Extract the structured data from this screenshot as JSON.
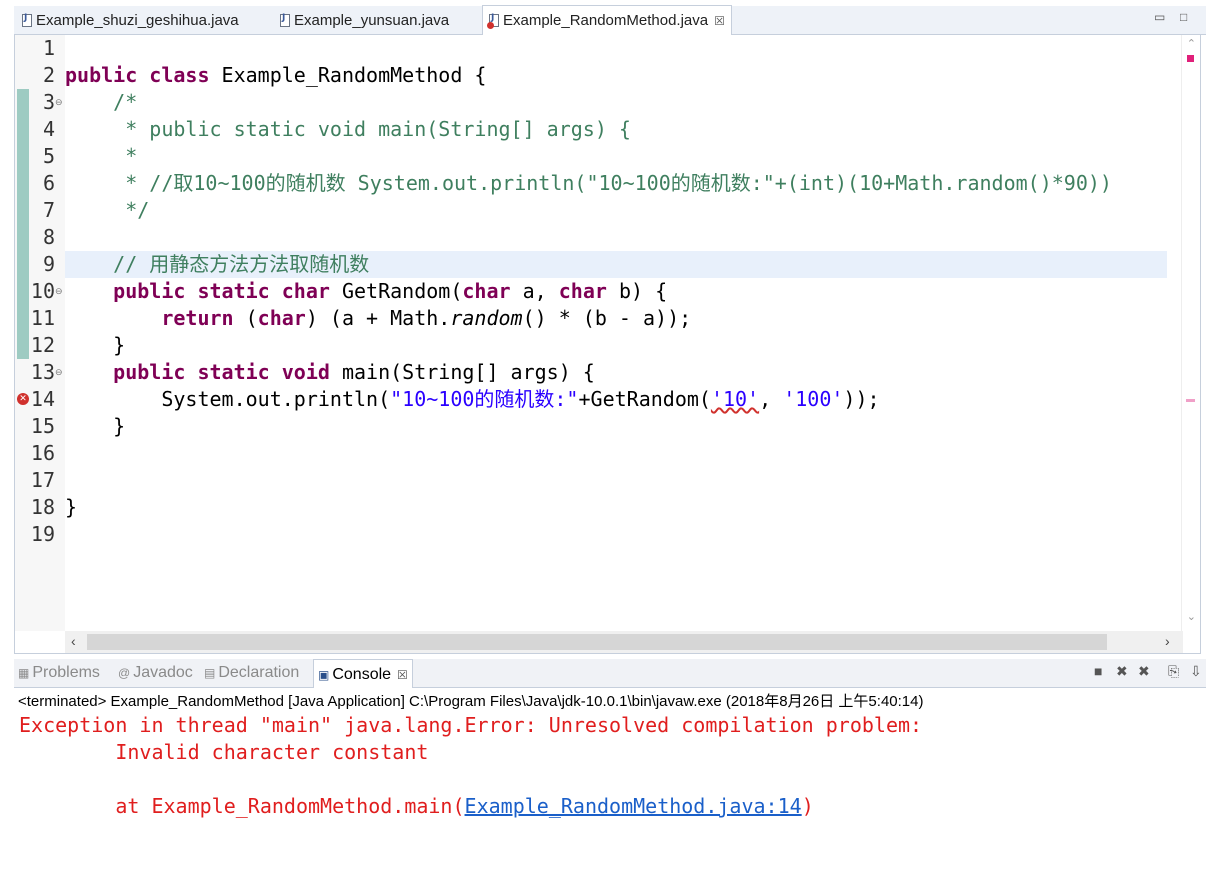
{
  "editor_tabs": [
    {
      "label": "Example_shuzi_geshihua.java",
      "icon": "java-file-icon",
      "active": false
    },
    {
      "label": "Example_yunsuan.java",
      "icon": "java-file-icon",
      "active": false
    },
    {
      "label": "Example_RandomMethod.java",
      "icon": "java-file-error-icon",
      "active": true,
      "close": "☒"
    }
  ],
  "window_buttons": {
    "minimize": "▭",
    "maximize": "□"
  },
  "code": {
    "current_line": 9,
    "error_line": 14,
    "line_numbers": [
      "1",
      "2",
      "3",
      "4",
      "5",
      "6",
      "7",
      "8",
      "9",
      "10",
      "11",
      "12",
      "13",
      "14",
      "15",
      "16",
      "17",
      "18",
      "19"
    ],
    "lines": {
      "l2": {
        "kw1": "public",
        "kw2": "class",
        "rest": " Example_RandomMethod {"
      },
      "l3": "/*",
      "l4": " * public static void main(String[] args) {",
      "l5": " *",
      "l6": " * //取10~100的随机数 System.out.println(\"10~100的随机数:\"+(int)(10+Math.random()*90))",
      "l7": " */",
      "l9": "// 用静态方法方法取随机数",
      "l10": {
        "kw1": "public",
        "kw2": "static",
        "kw3": "char",
        "name": " GetRandom(",
        "kw4": "char",
        "p1": " a, ",
        "kw5": "char",
        "p2": " b) {"
      },
      "l11": {
        "kw1": "return",
        "t1": " (",
        "kw2": "char",
        "t2": ") (a + Math.",
        "it": "random",
        "t3": "() * (b - a));"
      },
      "l12": "}",
      "l13": {
        "kw1": "public",
        "kw2": "static",
        "kw3": "void",
        "rest": " main(String[] args) {"
      },
      "l14": {
        "t1": "System.out.println(",
        "s1": "\"10~100的随机数:\"",
        "t2": "+GetRandom(",
        "s2": "'10'",
        "t3": ", ",
        "s3": "'100'",
        "t4": "));"
      },
      "l15": "}",
      "l18": "}"
    }
  },
  "view_tabs": [
    {
      "label": "Problems",
      "icon": "problems-icon",
      "active": false
    },
    {
      "label": "Javadoc",
      "icon": "at-icon",
      "active": false
    },
    {
      "label": "Declaration",
      "icon": "declaration-icon",
      "active": false
    },
    {
      "label": "Console",
      "icon": "console-icon",
      "active": true,
      "close": "☒"
    }
  ],
  "console": {
    "status": "<terminated> Example_RandomMethod [Java Application] C:\\Program Files\\Java\\jdk-10.0.1\\bin\\javaw.exe (2018年8月26日 上午5:40:14)",
    "line1": "Exception in thread \"main\" java.lang.Error: Unresolved compilation problem: ",
    "line2": "        Invalid character constant",
    "line3_prefix": "        at Example_RandomMethod.main(",
    "line3_link": "Example_RandomMethod.java:14",
    "line3_suffix": ")"
  },
  "colors": {
    "keyword": "#7f0055",
    "comment": "#3f7f5f",
    "string": "#2a00ff",
    "error": "#e01e1e",
    "link": "#1a5fc9"
  }
}
